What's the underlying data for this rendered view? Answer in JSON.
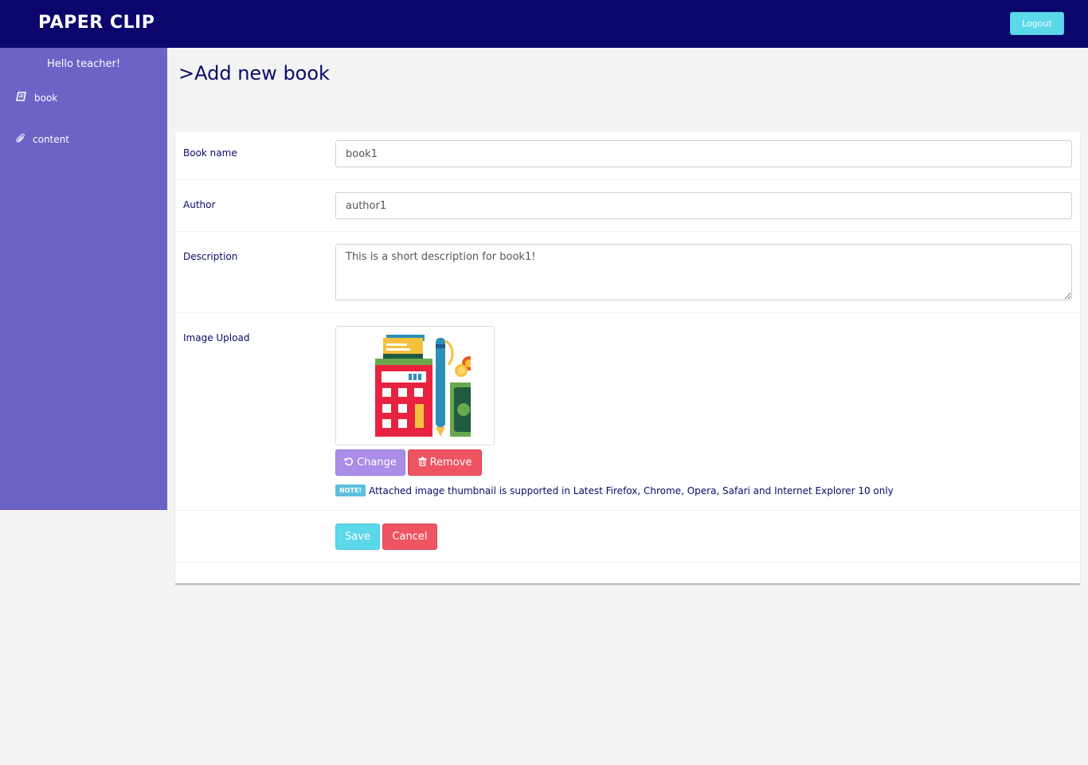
{
  "header": {
    "brand": "PAPER CLIP",
    "logout_label": "Logout"
  },
  "sidebar": {
    "greeting": "Hello teacher!",
    "items": [
      {
        "label": "book",
        "icon": "book-icon"
      },
      {
        "label": "content",
        "icon": "paperclip-icon"
      }
    ]
  },
  "page": {
    "title": ">Add new book"
  },
  "form": {
    "book_name": {
      "label": "Book name",
      "value": "book1"
    },
    "author": {
      "label": "Author",
      "value": "author1"
    },
    "description": {
      "label": "Description",
      "value": "This is a short description for book1!"
    },
    "image_upload": {
      "label": "Image Upload",
      "change_label": "Change",
      "remove_label": "Remove",
      "note_badge": "NOTE!",
      "note_text": "Attached image thumbnail is supported in Latest Firefox, Chrome, Opera, Safari and Internet Explorer 10 only"
    },
    "save_label": "Save",
    "cancel_label": "Cancel"
  },
  "colors": {
    "topbar": "#0a066c",
    "sidebar": "#6b64c6",
    "accent_cyan": "#5bd8e9",
    "danger": "#ee5462",
    "change_purple": "#a98de6"
  }
}
